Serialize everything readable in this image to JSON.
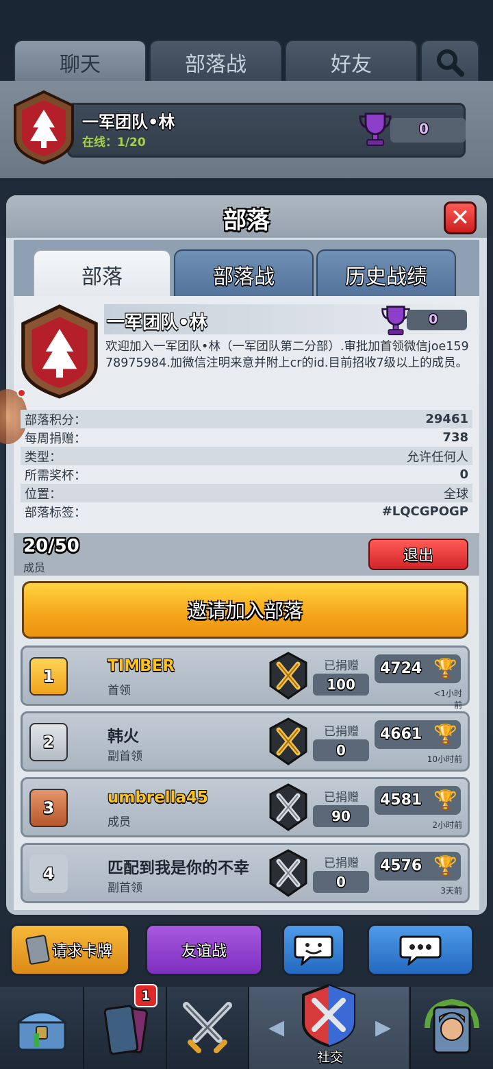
{
  "top_tabs": [
    {
      "label": "聊天"
    },
    {
      "label": "部落战"
    },
    {
      "label": "好友"
    }
  ],
  "bg_clan": {
    "name": "一军团队•林",
    "online": "在线：1/20",
    "trophies": "0"
  },
  "modal": {
    "title": "部落"
  },
  "sub_tabs": [
    {
      "label": "部落"
    },
    {
      "label": "部落战"
    },
    {
      "label": "历史战绩"
    }
  ],
  "clan": {
    "name": "一军团队•林",
    "trophies": "0",
    "description": "欢迎加入一军团队•林（一军团队第二分部）.审批加首领微信joe15978975984.加微信注明来意并附上cr的id.目前招收7级以上的成员。",
    "stats": [
      {
        "label": "部落积分：",
        "value": "29461"
      },
      {
        "label": "每周捐赠：",
        "value": "738"
      },
      {
        "label": "类型：",
        "value": "允许任何人"
      },
      {
        "label": "所需奖杯：",
        "value": "0"
      },
      {
        "label": "位置：",
        "value": "全球"
      },
      {
        "label": "部落标签：",
        "value": "#LQCGPOGP"
      }
    ]
  },
  "members_summary": {
    "count": "20/50",
    "label": "成员",
    "leave_label": "退出"
  },
  "invite_label": "邀请加入部落",
  "donated_label": "已捐赠",
  "members": [
    {
      "rank": "1",
      "name": "TIMBER",
      "role": "首领",
      "donated": "100",
      "trophies": "4724",
      "time": "<1小时前",
      "badge": "gold"
    },
    {
      "rank": "2",
      "name": "韩火",
      "role": "副首领",
      "donated": "0",
      "trophies": "4661",
      "time": "10小时前",
      "badge": "gold"
    },
    {
      "rank": "3",
      "name": "umbrella45",
      "role": "成员",
      "donated": "90",
      "trophies": "4581",
      "time": "2小时前",
      "badge": "silver"
    },
    {
      "rank": "4",
      "name": "匹配到我是你的不幸",
      "role": "副首领",
      "donated": "0",
      "trophies": "4576",
      "time": "3天前",
      "badge": "silver"
    }
  ],
  "actions": {
    "request_cards": "请求卡牌",
    "friendly_battle": "友谊战"
  },
  "nav": {
    "cards_badge": "1",
    "social_label": "社交"
  },
  "colors": {
    "accent_gold": "#f5a51a",
    "danger": "#d3252a",
    "purple": "#8e3fc9",
    "blue": "#2f74c9"
  }
}
